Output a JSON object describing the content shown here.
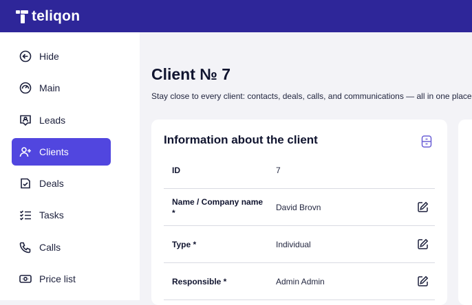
{
  "brand": {
    "name": "teliqon"
  },
  "sidebar": {
    "items": [
      {
        "label": "Hide",
        "icon": "arrow-left-circle-icon"
      },
      {
        "label": "Main",
        "icon": "dashboard-gauge-icon"
      },
      {
        "label": "Leads",
        "icon": "lead-badge-icon"
      },
      {
        "label": "Clients",
        "icon": "user-plus-icon",
        "active": true
      },
      {
        "label": "Deals",
        "icon": "deal-document-icon"
      },
      {
        "label": "Tasks",
        "icon": "task-list-icon"
      },
      {
        "label": "Calls",
        "icon": "phone-icon"
      },
      {
        "label": "Price list",
        "icon": "money-bill-icon"
      }
    ]
  },
  "page": {
    "title": "Client № 7",
    "subtitle": "Stay close to every client: contacts, deals, calls, and communications — all in one place."
  },
  "info_card": {
    "title": "Information about the client",
    "icon": "device-icon",
    "rows": [
      {
        "label": "ID",
        "value": "7",
        "editable": false
      },
      {
        "label": "Name / Company name *",
        "value": "David Brovn",
        "editable": true
      },
      {
        "label": "Type *",
        "value": "Individual",
        "editable": true
      },
      {
        "label": "Responsible *",
        "value": "Admin Admin",
        "editable": true
      }
    ]
  },
  "colors": {
    "topbar": "#2e2699",
    "accent": "#5146df",
    "icon": "#6a5fd6"
  }
}
